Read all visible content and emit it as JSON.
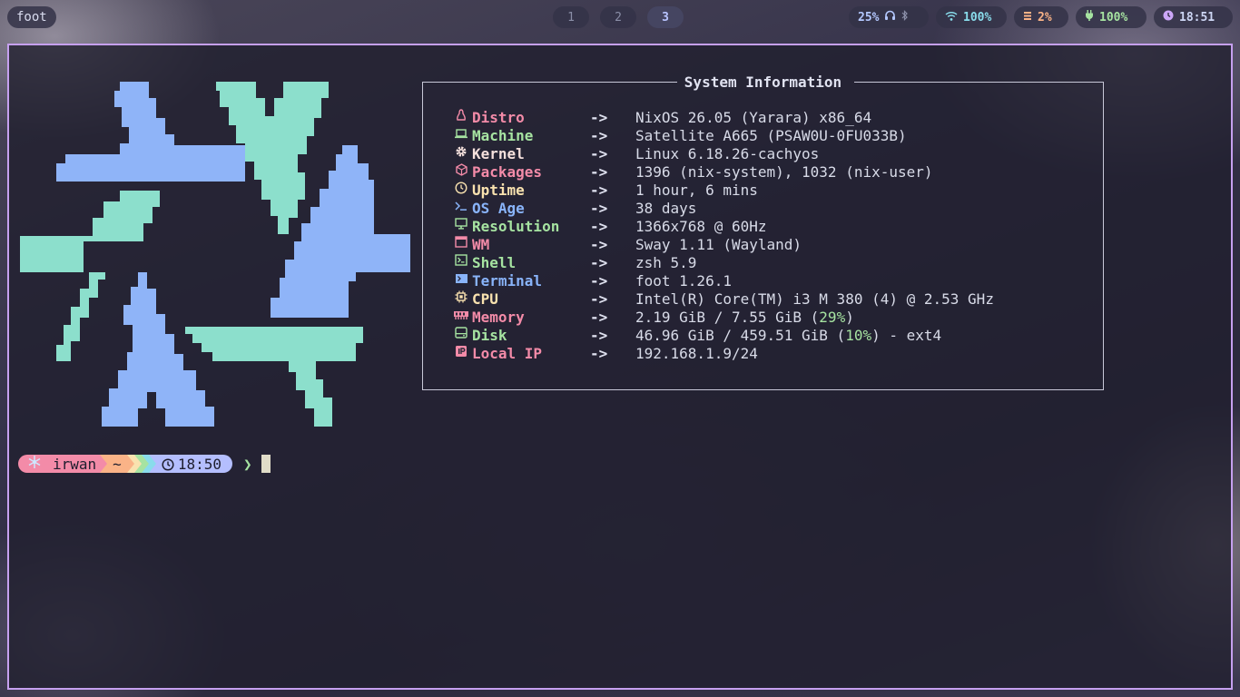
{
  "window_title": "foot",
  "workspaces": [
    "1",
    "2",
    "3"
  ],
  "active_workspace": "3",
  "status": {
    "volume": "25%",
    "volume_icon": "headphones-icon",
    "bluetooth_icon": "bluetooth-icon",
    "wifi": "100%",
    "wifi_icon": "wifi-icon",
    "cpu": "2%",
    "cpu_icon": "memory-chip-icon",
    "battery": "100%",
    "battery_icon": "plug-icon",
    "clock": "18:51",
    "clock_icon": "clock-icon"
  },
  "colors": {
    "border": "#c6a0f0",
    "red": "#f38ba8",
    "green": "#a6e3a1",
    "yellow": "#f9e2af",
    "blue": "#89b4fa",
    "logo_blue": "#8fb4f8",
    "logo_teal": "#8cdfcc"
  },
  "sysinfo": {
    "title": "System Information",
    "arrow": "->",
    "rows": [
      {
        "icon": "linux-icon",
        "label": "Distro",
        "value": "NixOS 26.05 (Yarara) x86_64"
      },
      {
        "icon": "laptop-icon",
        "label": "Machine",
        "value": "Satellite A665 (PSAW0U-0FU033B)"
      },
      {
        "icon": "gear-icon",
        "label": "Kernel",
        "value": "Linux 6.18.26-cachyos"
      },
      {
        "icon": "package-icon",
        "label": "Packages",
        "value": "1396 (nix-system), 1032 (nix-user)"
      },
      {
        "icon": "clock-icon",
        "label": "Uptime",
        "value": "1 hour, 6 mins"
      },
      {
        "icon": "terminal-prompt-icon",
        "label": "OS Age",
        "value": "38 days"
      },
      {
        "icon": "monitor-icon",
        "label": "Resolution",
        "value": "1366x768 @ 60Hz"
      },
      {
        "icon": "window-icon",
        "label": "WM",
        "value": "Sway 1.11 (Wayland)"
      },
      {
        "icon": "shell-icon",
        "label": "Shell",
        "value": "zsh 5.9"
      },
      {
        "icon": "terminal-icon",
        "label": "Terminal",
        "value": "foot 1.26.1"
      },
      {
        "icon": "cpu-icon",
        "label": "CPU",
        "value": "Intel(R) Core(TM) i3 M 380 (4) @ 2.53 GHz"
      },
      {
        "icon": "memory-icon",
        "label": "Memory",
        "value_pre": "2.19 GiB / 7.55 GiB (",
        "value_pct": "29%",
        "value_post": ")"
      },
      {
        "icon": "disk-icon",
        "label": "Disk",
        "value_pre": "46.96 GiB / 459.51 GiB (",
        "value_pct": "10%",
        "value_post": ") - ext4"
      },
      {
        "icon": "network-icon",
        "label": "Local IP",
        "value": "192.168.1.9/24"
      }
    ]
  },
  "prompt": {
    "os_icon": "snowflake-icon",
    "user": "irwan",
    "dir": "~",
    "time_icon": "clock-icon",
    "time": "18:50",
    "symbol": "❯"
  }
}
